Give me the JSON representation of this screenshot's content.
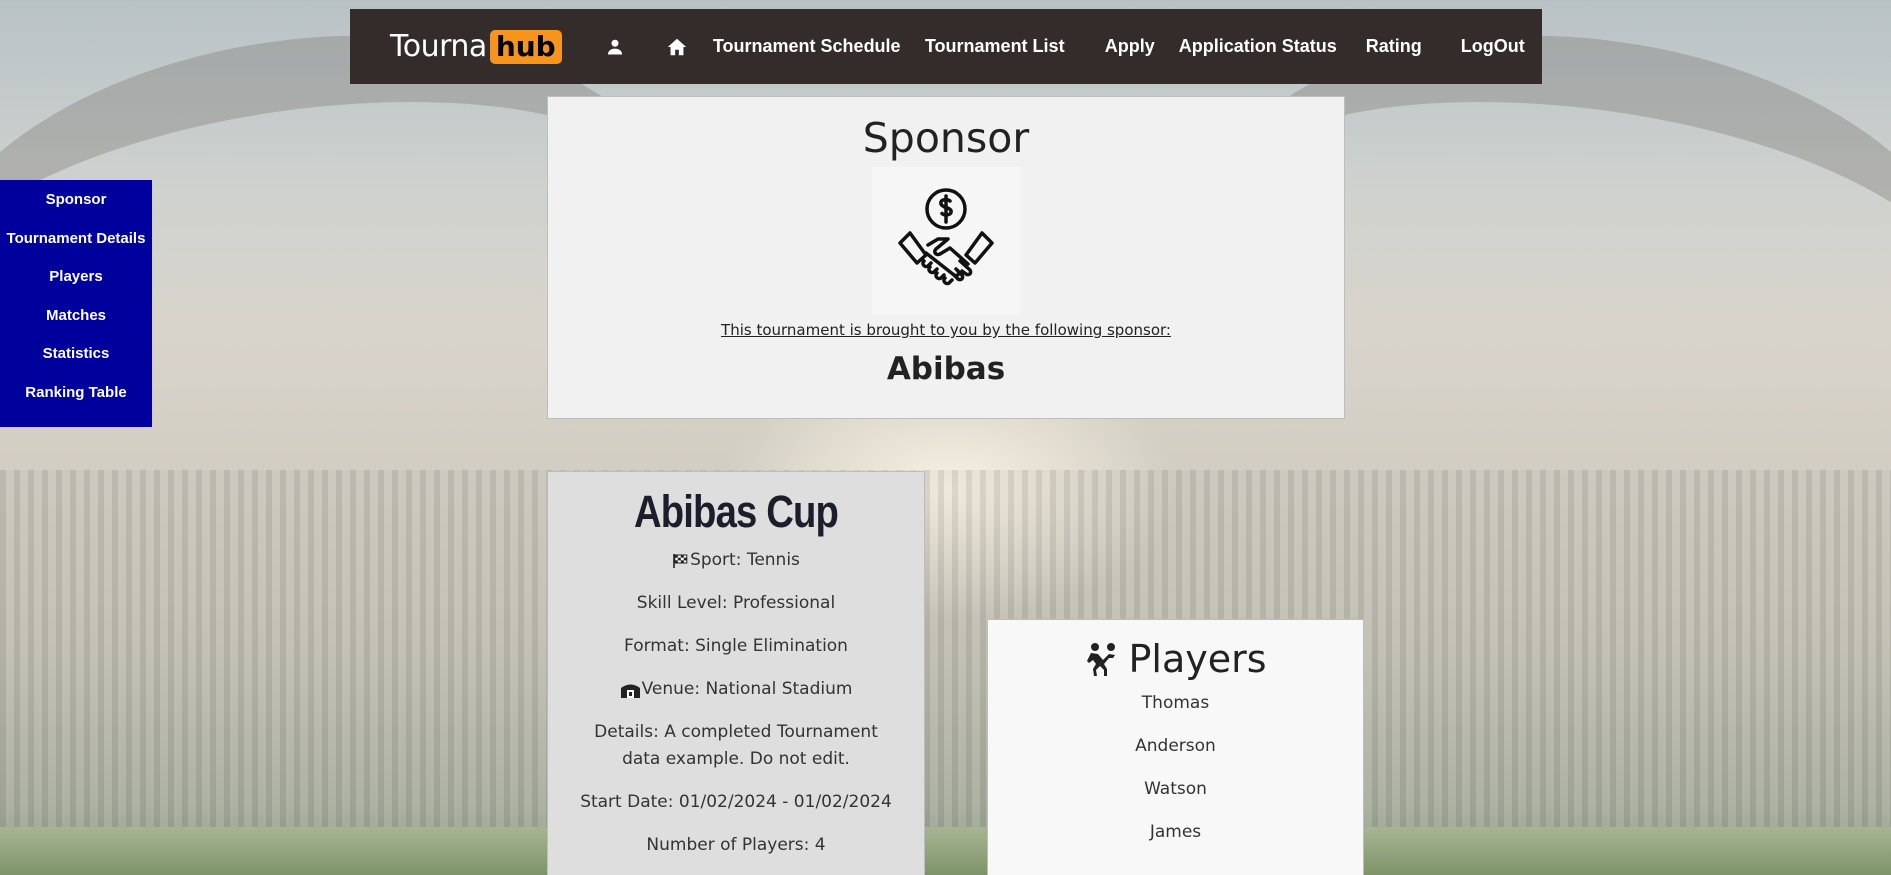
{
  "header": {
    "logo_text": "Tourna",
    "logo_badge": "hub",
    "icons": [
      "user-icon",
      "home-icon"
    ],
    "nav": {
      "schedule": "Tournament Schedule",
      "list": "Tournament List",
      "apply": "Apply",
      "status": "Application Status",
      "rating": "Rating",
      "logout": "LogOut"
    }
  },
  "sidebar": {
    "items": [
      "Sponsor",
      "Tournament Details",
      "Players",
      "Matches",
      "Statistics",
      "Ranking Table"
    ]
  },
  "sponsor": {
    "title": "Sponsor",
    "caption": "This tournament is brought to you by the following sponsor:",
    "name": "Abibas",
    "icon": "sponsor-handshake-icon"
  },
  "tournament": {
    "name": "Abibas Cup",
    "sport": "Sport: Tennis",
    "skill": "Skill Level: Professional",
    "format": "Format: Single Elimination",
    "venue": "Venue: National Stadium",
    "details": "Details: A completed Tournament data example. Do not edit.",
    "dates": "Start Date: 01/02/2024 - 01/02/2024",
    "count": "Number of Players: 4"
  },
  "players": {
    "title": "Players",
    "names": [
      "Thomas",
      "Anderson",
      "Watson",
      "James"
    ]
  },
  "colors": {
    "navbar": "#342b2b",
    "logo_badge": "#f7941d",
    "sidebar": "#00009c",
    "sponsor_card": "#f1f1f1",
    "details_card": "#dedede",
    "players_card": "#f8f8f8"
  }
}
